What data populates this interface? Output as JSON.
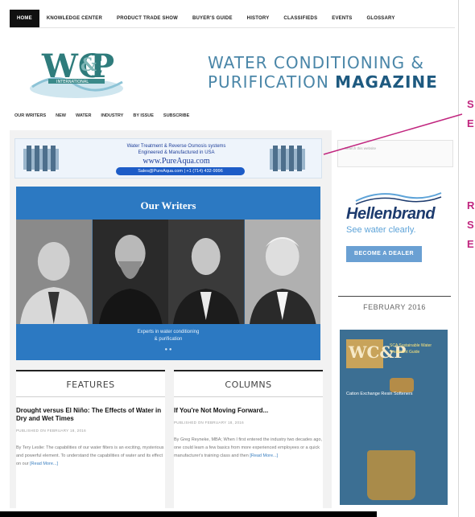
{
  "topnav": [
    "HOME",
    "KNOWLEDGE CENTER",
    "PRODUCT TRADE SHOW",
    "BUYER'S GUIDE",
    "HISTORY",
    "CLASSIFIEDS",
    "EVENTS",
    "GLOSSARY"
  ],
  "logo": {
    "letters": "WC&P",
    "sub": "INTERNATIONAL"
  },
  "masthead": {
    "line1": "WATER CONDITIONING &",
    "line2_plain": "PURIFICATION ",
    "line2_bold": "MAGAZINE"
  },
  "subnav": [
    "OUR WRITERS",
    "NEW",
    "WATER",
    "INDUSTRY",
    "BY ISSUE",
    "SUBSCRIBE"
  ],
  "banner": {
    "line1": "Water Treatment & Reverse Osmosis systems",
    "line2": "Engineered & Manufactured in USA",
    "url": "www.PureAqua.com",
    "contact": "Sales@PureAqua.com | +1 (714) 432-9996"
  },
  "writers": {
    "title": "Our Writers",
    "caption_line1": "Experts in water conditioning",
    "caption_line2": "& purification",
    "dots": "● ●"
  },
  "features": {
    "heading": "FEATURES",
    "headline": "Drought versus El Niño: The Effects of Water in Dry and Wet Times",
    "meta": "PUBLISHED ON FEBRUARY 18, 2016",
    "excerpt": "By Tery Leslie: The capabilities of our water filters is an exciting, mysterious and powerful element. To understand the capabilities of water and its effect on our",
    "more": "[Read More...]"
  },
  "columns": {
    "heading": "COLUMNS",
    "headline": "If You're Not Moving Forward...",
    "meta": "PUBLISHED ON FEBRUARY 18, 2016",
    "excerpt": "By Greg Reyneke, MBA; When I first entered the industry two decades ago, one could learn a few basics from more experienced employees or a quick manufacturer's training class and then",
    "more": "[Read More...]"
  },
  "sidebar": {
    "search_placeholder": "Search this website",
    "hb_name": "Hellenbrand",
    "hb_tag": "See water clearly.",
    "hb_button": "BECOME A DEALER",
    "issue_label": "FEBRUARY 2016",
    "cover_blurb": "SCA Sustainable Water Treatment Guide",
    "cover_tagline": "Cation Exchange Resin Softeners"
  },
  "callouts": {
    "first": [
      "S",
      "E"
    ],
    "second": [
      "R",
      "S",
      "E"
    ]
  },
  "colors": {
    "accent": "#2c79c2",
    "callout": "#c1267f",
    "brand": "#1d3b6e"
  }
}
